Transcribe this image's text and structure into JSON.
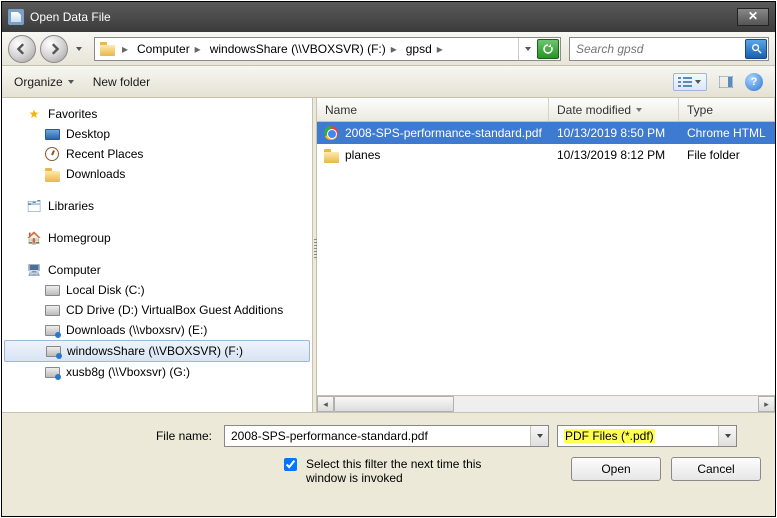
{
  "window": {
    "title": "Open Data File"
  },
  "breadcrumb": {
    "items": [
      "Computer",
      "windowsShare (\\\\VBOXSVR) (F:)",
      "gpsd"
    ]
  },
  "search": {
    "placeholder": "Search gpsd"
  },
  "toolbar": {
    "organize": "Organize",
    "newfolder": "New folder"
  },
  "nav": {
    "favorites": {
      "label": "Favorites",
      "items": [
        "Desktop",
        "Recent Places",
        "Downloads"
      ]
    },
    "libraries": {
      "label": "Libraries"
    },
    "homegroup": {
      "label": "Homegroup"
    },
    "computer": {
      "label": "Computer",
      "items": [
        "Local Disk (C:)",
        "CD Drive (D:) VirtualBox Guest Additions",
        "Downloads (\\\\vboxsrv) (E:)",
        "windowsShare (\\\\VBOXSVR) (F:)",
        "xusb8g (\\\\Vboxsvr) (G:)"
      ]
    }
  },
  "columns": {
    "name": "Name",
    "date": "Date modified",
    "type": "Type"
  },
  "rows": [
    {
      "name": "2008-SPS-performance-standard.pdf",
      "date": "10/13/2019 8:50 PM",
      "type": "Chrome HTML",
      "icon": "chrome",
      "selected": true
    },
    {
      "name": "planes",
      "date": "10/13/2019 8:12 PM",
      "type": "File folder",
      "icon": "folder",
      "selected": false
    }
  ],
  "footer": {
    "filename_label": "File name:",
    "filename_value": "2008-SPS-performance-standard.pdf",
    "filter_value": "PDF Files (*.pdf)",
    "remember_label": "Select this filter the next time this window is invoked",
    "remember_checked": true,
    "open": "Open",
    "cancel": "Cancel"
  }
}
